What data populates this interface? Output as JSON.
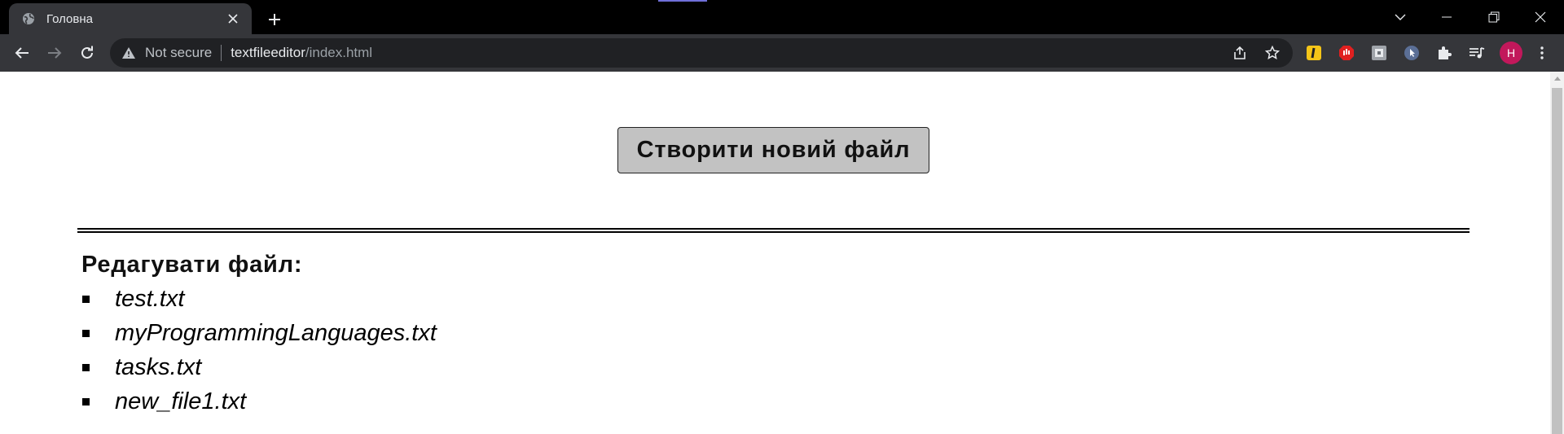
{
  "browser": {
    "tab_title": "Головна",
    "security_text": "Not secure",
    "url_host": "textfileeditor",
    "url_path": "/index.html",
    "avatar_initial": "H",
    "colors": {
      "titlebar": "#000000",
      "tab": "#35363a",
      "omnibox": "#202124",
      "avatar": "#c2185b"
    },
    "extensions": [
      "notes-extension-icon",
      "adblock-extension-icon",
      "screenshot-extension-icon",
      "cursor-extension-icon",
      "puzzle-icon",
      "media-control-icon"
    ]
  },
  "page": {
    "create_button": "Створити новий файл",
    "edit_heading": "Редагувати файл:",
    "files": [
      {
        "name": "test.txt"
      },
      {
        "name": "myProgrammingLanguages.txt"
      },
      {
        "name": "tasks.txt"
      },
      {
        "name": "new_file1.txt"
      }
    ],
    "colors": {
      "button_bg": "#c2c2c2",
      "text": "#111111"
    }
  }
}
